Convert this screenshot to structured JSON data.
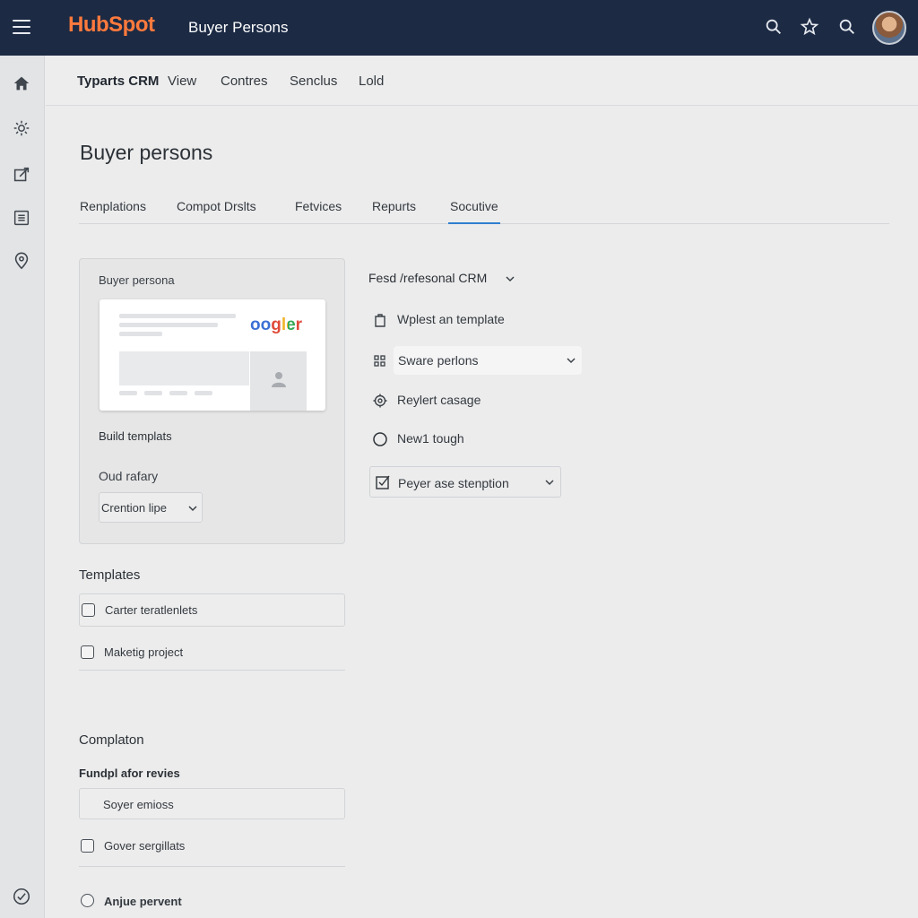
{
  "header": {
    "logo_text": "HubSpot",
    "app_title": "Buyer Persons"
  },
  "subnav": {
    "brand": "Typarts CRM",
    "items": [
      "View",
      "Contres",
      "Senclus",
      "Lold"
    ]
  },
  "page": {
    "title": "Buyer persons"
  },
  "tabs": [
    {
      "label": "Renplations",
      "active": false
    },
    {
      "label": "Compot Drslts",
      "active": false
    },
    {
      "label": "Fetvices",
      "active": false
    },
    {
      "label": "Repurts",
      "active": false
    },
    {
      "label": "Socutive",
      "active": true
    }
  ],
  "persona_card": {
    "label": "Buyer persona",
    "preview_logo": "oogler",
    "build_label": "Build templats",
    "field_label": "Oud rafary",
    "select_value": "Crention lipe"
  },
  "options": {
    "header": "Fesd /refesonal CRM",
    "items": [
      {
        "icon": "clipboard-icon",
        "label": "Wplest an template"
      },
      {
        "icon": "grid-icon",
        "label": "Sware perlons",
        "select": true
      },
      {
        "icon": "gear-icon",
        "label": "Reylert casage"
      },
      {
        "icon": "radio-icon",
        "label": "New1 tough"
      },
      {
        "icon": "checkbox-icon",
        "label": "Peyer ase stenption",
        "select": true
      }
    ]
  },
  "templates": {
    "title": "Templates",
    "items": [
      {
        "label": "Carter teratlenlets",
        "checked": false
      },
      {
        "label": "Maketig project",
        "checked": false
      }
    ]
  },
  "completion": {
    "title": "Complaton",
    "sublabel": "Fundpl afor revies",
    "input_value": "Soyer emioss",
    "checkbox_label": "Gover sergillats",
    "radio_label": "Anjue pervent"
  },
  "colors": {
    "header_bg": "#1c2a44",
    "brand_orange": "#ff7a3d",
    "tab_active": "#2f7fcf"
  }
}
